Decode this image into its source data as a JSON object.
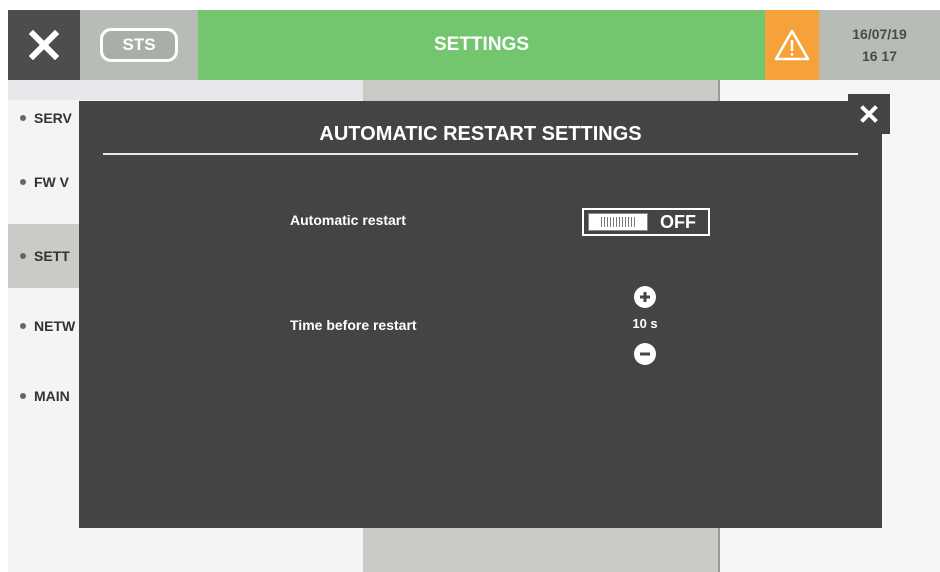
{
  "header": {
    "title": "SETTINGS",
    "sts_label": "STS",
    "date": "16/07/19",
    "time": "16 17"
  },
  "sidebar": {
    "items": [
      {
        "label": "SERV"
      },
      {
        "label": "FW V"
      },
      {
        "label": "SETT"
      },
      {
        "label": "NETW"
      },
      {
        "label": "MAIN"
      }
    ]
  },
  "modal": {
    "title": "AUTOMATIC RESTART SETTINGS",
    "automatic_restart": {
      "label": "Automatic restart",
      "state": "OFF"
    },
    "time_before_restart": {
      "label": "Time before restart",
      "value": "10 s"
    }
  },
  "colors": {
    "header_green": "#74c66e",
    "warning_orange": "#f6a23a",
    "modal_bg": "#444444",
    "dark_button": "#4d4d4d"
  },
  "icons": [
    "close-icon",
    "warning-icon",
    "plus-icon",
    "minus-icon"
  ]
}
